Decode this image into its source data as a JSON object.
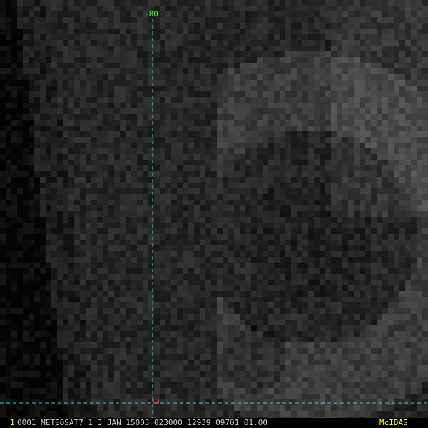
{
  "grid": {
    "meridian_label": "-80",
    "parallel_label": "-30",
    "line_color": "#33cccc",
    "label_color_lon": "#33ff33",
    "label_color_lat": "#ff3333"
  },
  "status": {
    "frame_number": "1",
    "frame_number_color": "#ffff33",
    "text": "0001 METEOSAT7  1  3 JAN 15003 023000 12939 09701 01.00",
    "text_color": "#cccccc",
    "brand": "McIDAS",
    "brand_color": "#ffff33"
  },
  "icons": {
    "imagery": "satellite-infrared-image"
  }
}
